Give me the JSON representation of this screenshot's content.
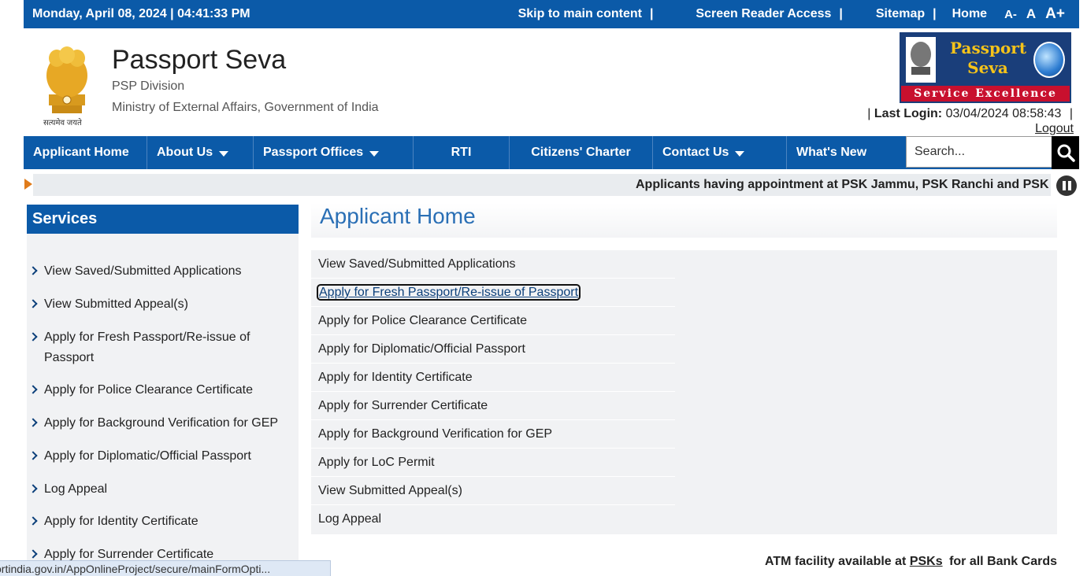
{
  "topbar": {
    "datetime": "Monday,  April  08, 2024 | 04:41:33 PM",
    "skip_link": "Skip to main content",
    "screen_reader": "Screen Reader Access",
    "sitemap": "Sitemap",
    "home": "Home",
    "separator": "|",
    "font_decrease": "A-",
    "font_normal": "A",
    "font_increase": "A+"
  },
  "header": {
    "title": "Passport Seva",
    "division": "PSP Division",
    "ministry": "Ministry of External Affairs, Government of India",
    "emblem_caption": "सत्यमेव जयते",
    "logo_line1": "Passport",
    "logo_line2": "Seva",
    "logo_band": "Service Excellence",
    "last_login_label": "Last Login:",
    "last_login_value": "03/04/2024 08:58:43",
    "separator": "|",
    "logout": "Logout"
  },
  "nav": {
    "items": [
      {
        "label": "Applicant Home"
      },
      {
        "label": "About Us"
      },
      {
        "label": "Passport Offices"
      },
      {
        "label": "RTI"
      },
      {
        "label": "Citizens' Charter"
      },
      {
        "label": "Contact Us"
      },
      {
        "label": "What's New"
      }
    ],
    "search_placeholder": "Search..."
  },
  "ticker": {
    "text": "Applicants having appointment at PSK Jammu, PSK Ranchi and PSK"
  },
  "sidebar": {
    "heading": "Services",
    "items": [
      {
        "label": "View Saved/Submitted Applications"
      },
      {
        "label": "View Submitted Appeal(s)"
      },
      {
        "label": "Apply for Fresh Passport/Re-issue of Passport"
      },
      {
        "label": "Apply for Police Clearance Certificate"
      },
      {
        "label": "Apply for Background Verification for GEP"
      },
      {
        "label": "Apply for Diplomatic/Official Passport"
      },
      {
        "label": "Log Appeal"
      },
      {
        "label": "Apply for Identity Certificate"
      },
      {
        "label": "Apply for Surrender Certificate"
      }
    ]
  },
  "main": {
    "title": "Applicant Home",
    "items": [
      {
        "label": "View Saved/Submitted Applications"
      },
      {
        "label": "Apply for Fresh Passport/Re-issue of Passport"
      },
      {
        "label": "Apply for Police Clearance Certificate"
      },
      {
        "label": "Apply for Diplomatic/Official Passport"
      },
      {
        "label": "Apply for Identity Certificate"
      },
      {
        "label": "Apply for Surrender Certificate"
      },
      {
        "label": "Apply for Background Verification for GEP"
      },
      {
        "label": "Apply for LoC Permit"
      },
      {
        "label": "View Submitted Appeal(s)"
      },
      {
        "label": "Log Appeal"
      }
    ],
    "atm_prefix": "ATM facility available at",
    "atm_link": "PSKs",
    "atm_suffix": "for all Bank Cards"
  },
  "statusbar": {
    "url": "ortindia.gov.in/AppOnlineProject/secure/mainFormOpti..."
  },
  "colors": {
    "brand_blue": "#0b5aa8",
    "ticker_arrow": "#e07b1a",
    "title_blue": "#2a6fb5"
  }
}
